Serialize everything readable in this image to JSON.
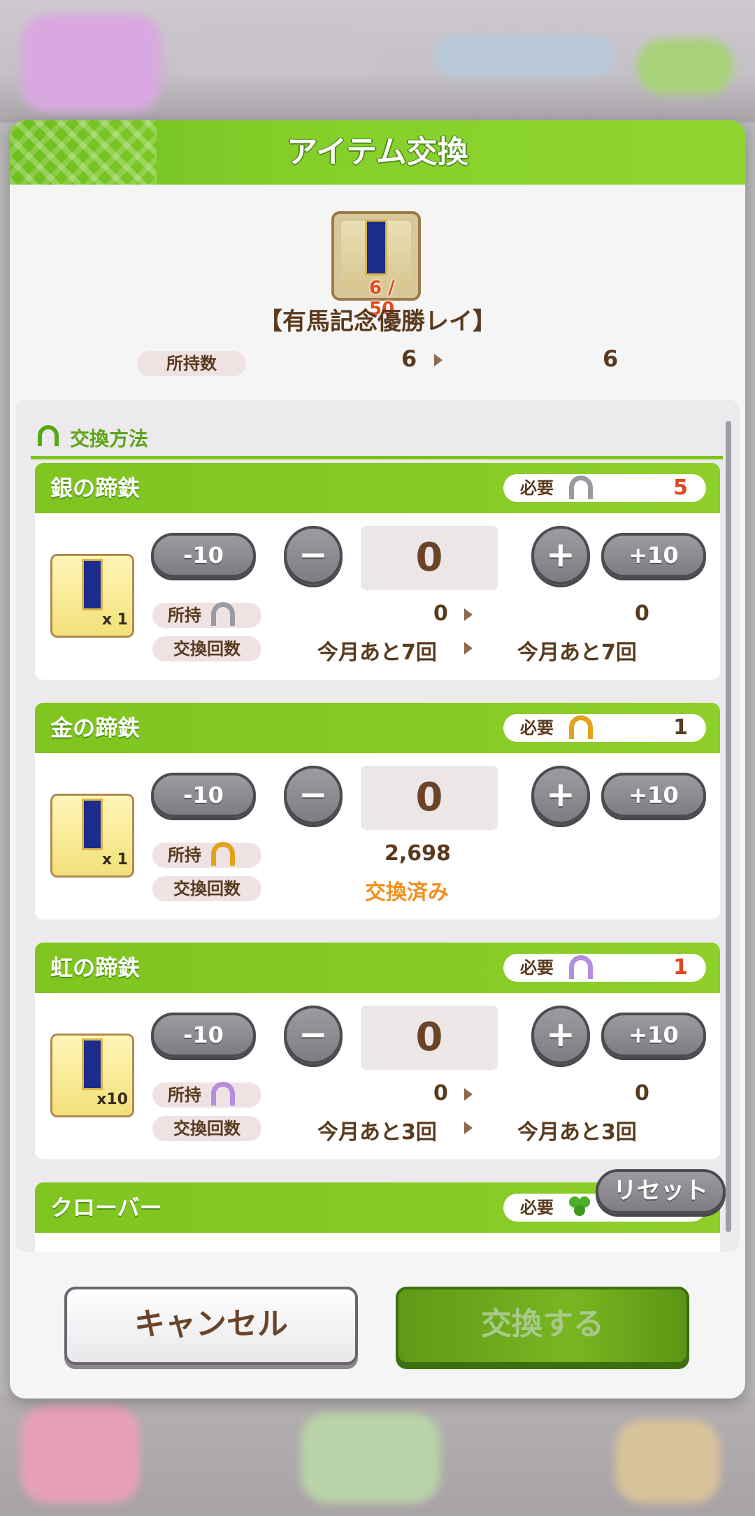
{
  "dialog": {
    "title": "アイテム交換",
    "item": {
      "name": "【有馬記念優勝レイ】",
      "count": "6 / 50"
    },
    "owned": {
      "label": "所持数",
      "before": "6",
      "after": "6"
    }
  },
  "exchange_section": {
    "title": "交換方法",
    "required_label": "必要",
    "owned_label": "所持",
    "count_label": "交換回数",
    "buttons": {
      "minus10": "-10",
      "minus": "−",
      "plus": "+",
      "plus10": "+10"
    },
    "methods": [
      {
        "name": "銀の蹄鉄",
        "required": "5",
        "required_color": "#e2451c",
        "icon": "silver-horseshoe-icon",
        "icon_color": "#9a9aa2",
        "quantity": "0",
        "reward": "x 1",
        "owned_before": "0",
        "owned_after": "0",
        "count_before": "今月あと7回",
        "count_after": "今月あと7回"
      },
      {
        "name": "金の蹄鉄",
        "required": "1",
        "required_color": "#5a3a1e",
        "icon": "gold-horseshoe-icon",
        "icon_color": "#e2a21c",
        "quantity": "0",
        "reward": "x 1",
        "owned_before": "2,698",
        "count_status": "交換済み",
        "count_status_color": "#f0901c"
      },
      {
        "name": "虹の蹄鉄",
        "required": "1",
        "required_color": "#e2451c",
        "icon": "rainbow-horseshoe-icon",
        "icon_color": "#b48ce0",
        "quantity": "0",
        "reward": "x10",
        "owned_before": "0",
        "owned_after": "0",
        "count_before": "今月あと3回",
        "count_after": "今月あと3回"
      },
      {
        "name": "クローバー",
        "icon": "clover-icon",
        "icon_color": "#4fae2a"
      }
    ],
    "reset": "リセット"
  },
  "footer": {
    "cancel": "キャンセル",
    "exchange": "交換する"
  }
}
